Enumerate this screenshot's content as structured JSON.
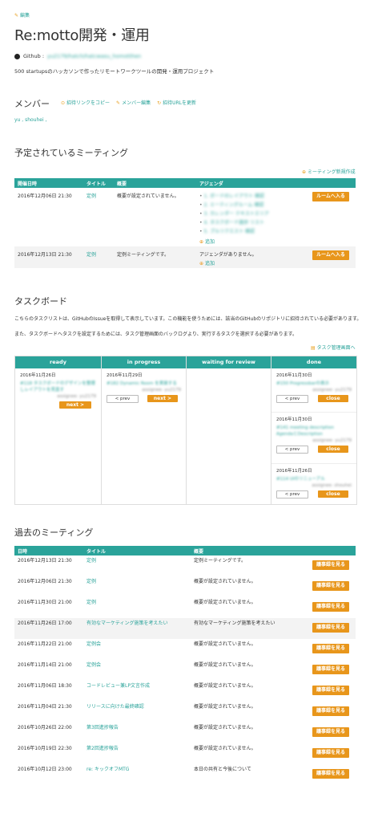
{
  "header": {
    "edit_label": "編集",
    "title": "Re:motto開発・運用",
    "github_label": "Github :",
    "github_url": "yu2179/hatch/hatcwasu_homotthen",
    "description": "500 startupsのハッカソンで作ったリモートワークツールの開発・運用プロジェクト"
  },
  "members": {
    "title": "メンバー",
    "copy_invite": "招待リンクをコピー",
    "edit_members": "メンバー編集",
    "regenerate_url": "招待URLを更新",
    "names": "yu , shouhei ,"
  },
  "scheduled": {
    "title": "予定されているミーティング",
    "new_link": "ミーティング新規作成",
    "columns": [
      "開催日時",
      "タイトル",
      "概要",
      "アジェンダ"
    ],
    "rows": [
      {
        "datetime": "2016年12月06日 21:30",
        "title": "定例",
        "summary": "概要が設定されていません。",
        "agenda": [
          "1. ボードのレイアウト 確認",
          "2. ミーティングルーム 確認",
          "3. カレンダー テキストエリア",
          "4. タスクボード進捗 リスト",
          "5. プルリクエスト 確認"
        ],
        "add_label": "追加",
        "enter_label": "ルームへ入る"
      },
      {
        "datetime": "2016年12月13日 21:30",
        "title": "定例",
        "summary": "定例ミーティングです。",
        "agenda_empty": "アジェンダがありません。",
        "add_label": "追加",
        "enter_label": "ルームへ入る"
      }
    ]
  },
  "taskboard": {
    "title": "タスクボード",
    "note1": "こちらのタスクリストは、GitHubのIssueを取得して表示しています。この機能を使うためには、該当のGitHubのリポジトリに招待されている必要があります。",
    "note2": "また、タスクボードへタスクを設定するためには、タスク管理画面のバックログより、実行するタスクを選択する必要があります。",
    "manage_link": "タスク管理画面へ",
    "prev_label": "< prev",
    "next_label": "next >",
    "close_label": "close",
    "columns": [
      {
        "name": "ready",
        "cards": [
          {
            "date": "2016年11月26日",
            "title": "#118 タスクボードのデザインを整理しレイアウトを見直す",
            "assignee": "assignee: yu2179"
          }
        ]
      },
      {
        "name": "in progress",
        "cards": [
          {
            "date": "2016年11月29日",
            "title": "#182 Dynamic Room を実装する",
            "assignee": "assignee: yu2179"
          }
        ]
      },
      {
        "name": "waiting for review",
        "cards": []
      },
      {
        "name": "done",
        "cards": [
          {
            "date": "2016年11月30日",
            "title": "#150 Progressbarの表示",
            "assignee": "assignee: yu2179"
          },
          {
            "date": "2016年11月30日",
            "title": "#141 meeting description AgendaとDescription",
            "assignee": "assignee: yu2179"
          },
          {
            "date": "2016年11月26日",
            "title": "#114 UIのリニューアル",
            "assignee": "assignee: shouhei"
          }
        ]
      }
    ]
  },
  "past": {
    "title": "過去のミーティング",
    "columns": [
      "日時",
      "タイトル",
      "概要"
    ],
    "view_label": "議事録を見る",
    "rows": [
      {
        "datetime": "2016年12月13日 21:30",
        "title": "定例",
        "summary": "定例ミーティングです。"
      },
      {
        "datetime": "2016年12月06日 21:30",
        "title": "定例",
        "summary": "概要が設定されていません。"
      },
      {
        "datetime": "2016年11月30日 21:00",
        "title": "定例",
        "summary": "概要が設定されていません。"
      },
      {
        "datetime": "2016年11月26日 17:00",
        "title": "有効なマーケティング施策を考えたい",
        "summary": "有効なマーケティング施策を考えたい"
      },
      {
        "datetime": "2016年11月22日 21:00",
        "title": "定例会",
        "summary": "概要が設定されていません。"
      },
      {
        "datetime": "2016年11月14日 21:00",
        "title": "定例会",
        "summary": "概要が設定されていません。"
      },
      {
        "datetime": "2016年11月06日 18:30",
        "title": "コードレビュー兼LP文言作成",
        "summary": "概要が設定されていません。"
      },
      {
        "datetime": "2016年11月04日 21:30",
        "title": "リリースに向けた最終確認",
        "summary": "概要が設定されていません。"
      },
      {
        "datetime": "2016年10月26日 22:00",
        "title": "第3回進捗報告",
        "summary": "概要が設定されていません。"
      },
      {
        "datetime": "2016年10月19日 22:30",
        "title": "第2回進捗報告",
        "summary": "概要が設定されていません。"
      },
      {
        "datetime": "2016年10月12日 23:00",
        "title": "re: キックオフMTG",
        "summary": "本日の共有と今後について"
      }
    ]
  },
  "colors": {
    "teal": "#2aa39a",
    "orange": "#e8961b"
  }
}
